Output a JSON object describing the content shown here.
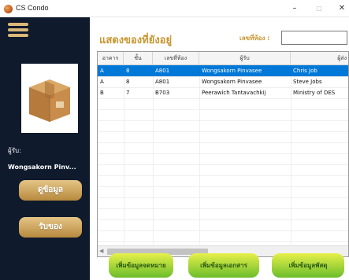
{
  "window": {
    "title": "CS Condo",
    "minimize": "–",
    "maximize": "□",
    "close": "✕"
  },
  "sidebar": {
    "recipient_label": "ผู้รับ:",
    "recipient_value": "Wongsakorn Pinv...",
    "view_button": "ดูข้อมูล",
    "receive_button": "รับของ"
  },
  "main": {
    "title": "แสดงของที่ยังอยู่",
    "room_label": "เลขที่ห้อง :",
    "room_value": ""
  },
  "table": {
    "columns": [
      "อาคาร",
      "ชั้น",
      "เลขที่ห้อง",
      "ผู้รับ",
      "ผู้ส่ง"
    ],
    "rows": [
      [
        "A",
        "8",
        "A801",
        "Wongsakorn Pinvasee",
        "Chris Job"
      ],
      [
        "A",
        "8",
        "A801",
        "Wongsakorn Pinvasee",
        "Steve Jobs"
      ],
      [
        "B",
        "7",
        "B703",
        "Peerawich Tantavachkij",
        "Ministry of DES"
      ]
    ],
    "selected_row": 0
  },
  "buttons": {
    "add_letter": "เพิ่มข้อมูลจดหมาย",
    "add_document": "เพิ่มข้อมูลเอกสาร",
    "add_parcel": "เพิ่มข้อมูลพัสดุ"
  },
  "colors": {
    "sidebar_bg": "#0f1a2c",
    "gold": "#c8962f",
    "selected_row": "#0078d7",
    "green_button": "#6bbd2a"
  },
  "icons": [
    "app-icon",
    "hamburger-menu-icon",
    "package-box-icon",
    "scroll-left-arrow-icon"
  ]
}
